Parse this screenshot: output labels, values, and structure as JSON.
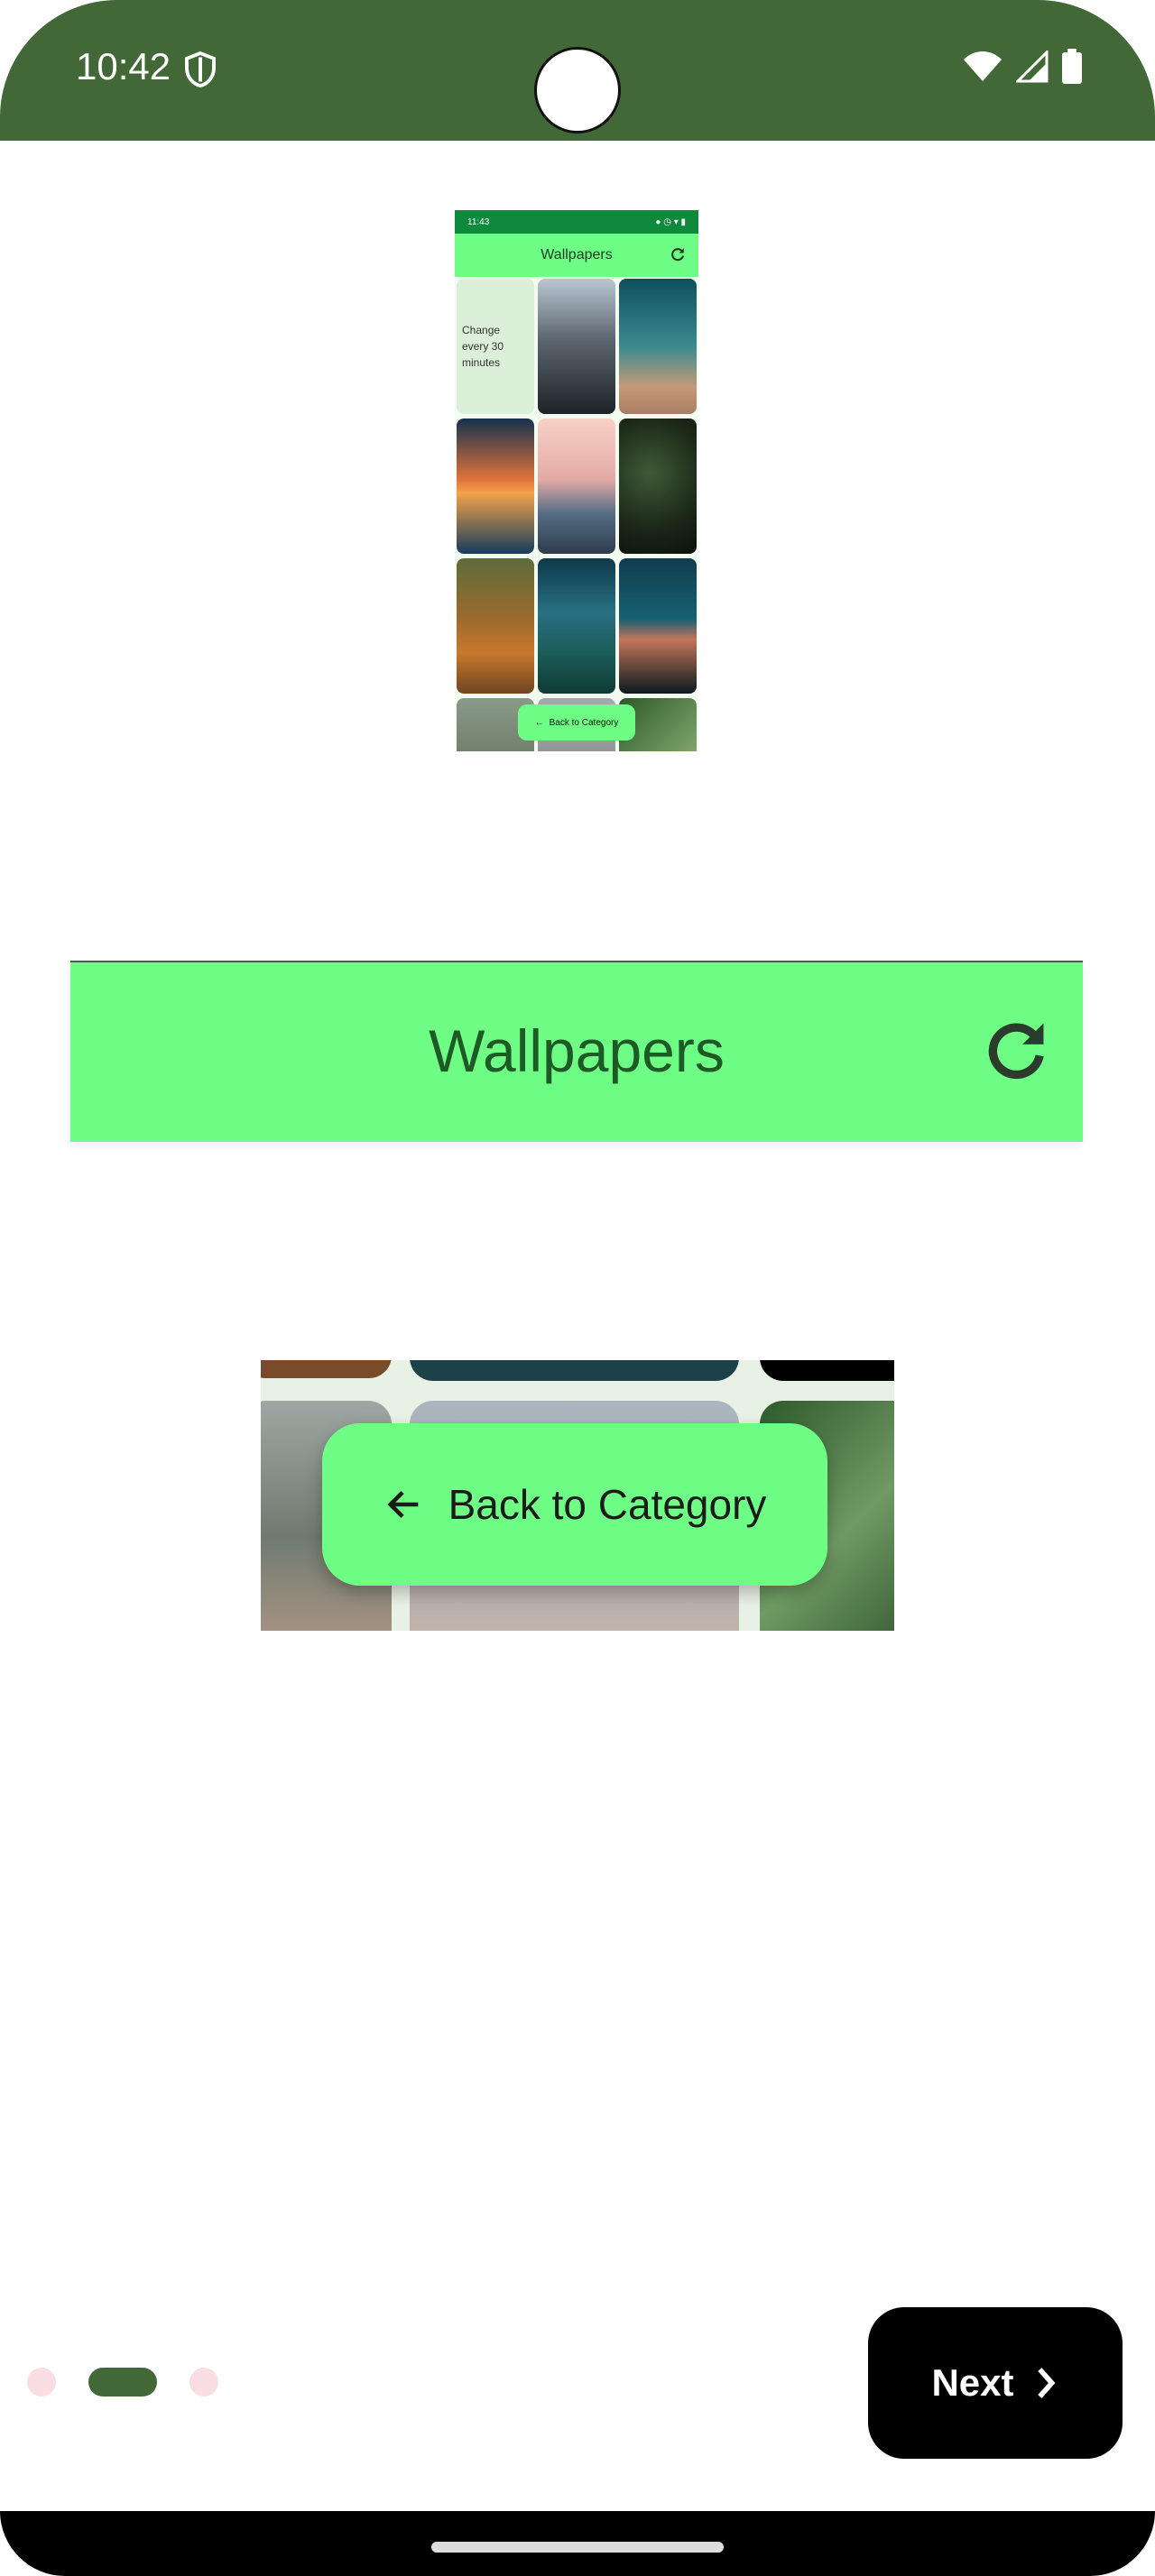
{
  "status_bar": {
    "time": "10:42",
    "background": "#426837",
    "icons": [
      "shield-icon",
      "wifi-icon",
      "signal-icon",
      "battery-icon"
    ]
  },
  "preview": {
    "status_time": "11:43",
    "app_title": "Wallpapers",
    "change_text": "Change every 30 minutes",
    "back_label": "Back to Category"
  },
  "app_bar": {
    "title": "Wallpapers",
    "refresh_icon": "refresh-icon",
    "background": "#6ffe85"
  },
  "cropped_button": {
    "label": "Back to Category",
    "icon": "arrow-left-icon"
  },
  "pager": {
    "page_count": 3,
    "active_index": 1
  },
  "next_button": {
    "label": "Next",
    "icon": "chevron-right-icon"
  }
}
